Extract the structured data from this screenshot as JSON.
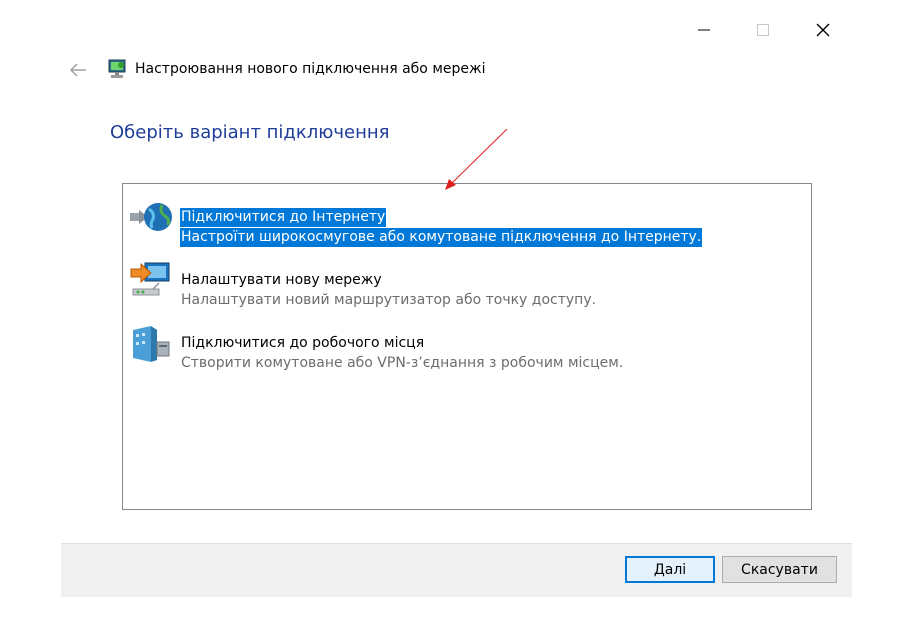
{
  "window": {
    "title": "Настроювання нового підключення або мережі",
    "caption_buttons": [
      "minimize-icon",
      "maximize-icon",
      "close-icon"
    ]
  },
  "page": {
    "heading": "Оберіть варіант підключення"
  },
  "options": [
    {
      "title": "Підключитися до Інтернету",
      "description": "Настроїти широкосмугове або комутоване підключення до Інтернету.",
      "icon": "globe-connect-icon",
      "selected": true
    },
    {
      "title": "Налаштувати нову мережу",
      "description": "Налаштувати новий маршрутизатор або точку доступу.",
      "icon": "new-network-icon",
      "selected": false
    },
    {
      "title": "Підключитися до робочого місця",
      "description": "Створити комутоване або VPN-з’єднання з робочим місцем.",
      "icon": "workplace-icon",
      "selected": false
    }
  ],
  "buttons": {
    "next": "Далі",
    "cancel": "Скасувати"
  },
  "colors": {
    "selection": "#0078d7",
    "heading": "#1f3d99",
    "annotation_arrow": "#e02020"
  }
}
